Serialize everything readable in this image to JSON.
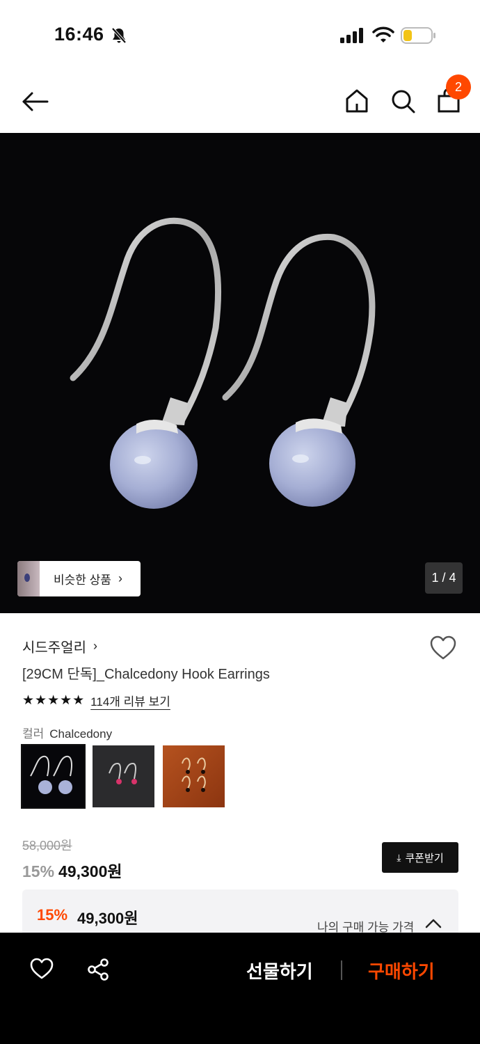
{
  "status_bar": {
    "time": "16:46",
    "icons": [
      "bell-slash-icon",
      "signal-icon",
      "wifi-icon",
      "battery-low-icon"
    ]
  },
  "nav": {
    "icons": [
      "back-arrow-icon",
      "home-icon",
      "search-icon",
      "shopping-bag-icon"
    ],
    "cart_count": "2"
  },
  "gallery": {
    "similar_label": "비슷한 상품",
    "page_indicator": "1 / 4"
  },
  "product": {
    "brand": "시드주얼리",
    "title": "[29CM 단독]_Chalcedony Hook Earrings",
    "stars": "★★★★★",
    "rating": 5,
    "review_link": "114개 리뷰 보기",
    "color_label": "컬러",
    "color_value": "Chalcedony",
    "swatches": [
      "Chalcedony",
      "Pink",
      "Black"
    ],
    "original_price": "58,000원",
    "discount": "15%",
    "price": "49,300원",
    "coupon_label": "쿠폰받기"
  },
  "best_price": {
    "discount": "15%",
    "price": "49,300원",
    "label": "나의 구매 가능 가격"
  },
  "bottom_bar": {
    "gift_label": "선물하기",
    "buy_label": "구매하기"
  },
  "colors": {
    "accent": "#ff4800",
    "dark": "#111111"
  }
}
